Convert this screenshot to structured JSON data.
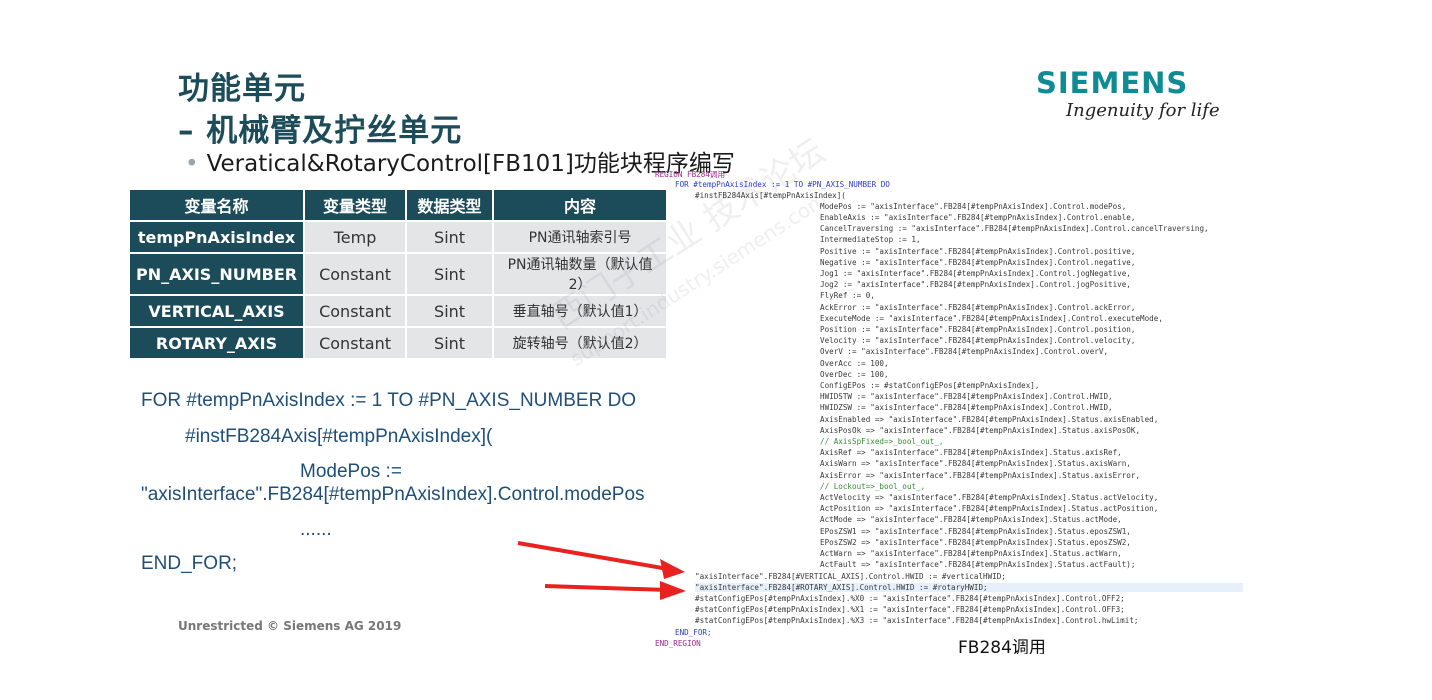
{
  "slide": {
    "title_line1": "功能单元",
    "title_line2": "– 机械臂及拧丝单元",
    "bullet_dot": "•",
    "bullet": "Veratical&RotaryControl[FB101]功能块程序编写",
    "logo": "SIEMENS",
    "tagline": "Ingenuity for life",
    "footer": "Unrestricted © Siemens AG 2019"
  },
  "table": {
    "headers": [
      "变量名称",
      "变量类型",
      "数据类型",
      "内容"
    ],
    "rows": [
      {
        "name": "tempPnAxisIndex",
        "vartype": "Temp",
        "datatype": "Sint",
        "content": "PN通讯轴索引号"
      },
      {
        "name": "PN_AXIS_NUMBER",
        "vartype": "Constant",
        "datatype": "Sint",
        "content": "PN通讯轴数量（默认值2）"
      },
      {
        "name": "VERTICAL_AXIS",
        "vartype": "Constant",
        "datatype": "Sint",
        "content": "垂直轴号（默认值1）"
      },
      {
        "name": "ROTARY_AXIS",
        "vartype": "Constant",
        "datatype": "Sint",
        "content": "旋转轴号（默认值2）"
      }
    ]
  },
  "code": {
    "line1": "FOR #tempPnAxisIndex := 1 TO #PN_AXIS_NUMBER DO",
    "line2": "#instFB284Axis[#tempPnAxisIndex](",
    "line3": "ModePos :=",
    "line4": "\"axisInterface\".FB284[#tempPnAxisIndex].Control.modePos",
    "line5": "......",
    "line6": "END_FOR;"
  },
  "scl": {
    "lines": [
      "REGION FB284调用",
      "FOR #tempPnAxisIndex := 1 TO #PN_AXIS_NUMBER DO",
      "#instFB284Axis[#tempPnAxisIndex](",
      "ModePos := \"axisInterface\".FB284[#tempPnAxisIndex].Control.modePos,",
      "EnableAxis := \"axisInterface\".FB284[#tempPnAxisIndex].Control.enable,",
      "CancelTraversing := \"axisInterface\".FB284[#tempPnAxisIndex].Control.cancelTraversing,",
      "IntermediateStop := 1,",
      "Positive := \"axisInterface\".FB284[#tempPnAxisIndex].Control.positive,",
      "Negative := \"axisInterface\".FB284[#tempPnAxisIndex].Control.negative,",
      "Jog1 := \"axisInterface\".FB284[#tempPnAxisIndex].Control.jogNegative,",
      "Jog2 := \"axisInterface\".FB284[#tempPnAxisIndex].Control.jogPositive,",
      "FlyRef := 0,",
      "AckError := \"axisInterface\".FB284[#tempPnAxisIndex].Control.ackError,",
      "ExecuteMode := \"axisInterface\".FB284[#tempPnAxisIndex].Control.executeMode,",
      "Position := \"axisInterface\".FB284[#tempPnAxisIndex].Control.position,",
      "Velocity := \"axisInterface\".FB284[#tempPnAxisIndex].Control.velocity,",
      "OverV := \"axisInterface\".FB284[#tempPnAxisIndex].Control.overV,",
      "OverAcc := 100,",
      "OverDec := 100,",
      "ConfigEPos := #statConfigEPos[#tempPnAxisIndex],",
      "HWIDSTW := \"axisInterface\".FB284[#tempPnAxisIndex].Control.HWID,",
      "HWIDZSW := \"axisInterface\".FB284[#tempPnAxisIndex].Control.HWID,",
      "AxisEnabled => \"axisInterface\".FB284[#tempPnAxisIndex].Status.axisEnabled,",
      "AxisPosOk => \"axisInterface\".FB284[#tempPnAxisIndex].Status.axisPosOK,",
      "// AxisSpFixed=>_bool_out_,",
      "AxisRef => \"axisInterface\".FB284[#tempPnAxisIndex].Status.axisRef,",
      "AxisWarn => \"axisInterface\".FB284[#tempPnAxisIndex].Status.axisWarn,",
      "AxisError => \"axisInterface\".FB284[#tempPnAxisIndex].Status.axisError,",
      "// Lockout=>_bool_out_,",
      "ActVelocity => \"axisInterface\".FB284[#tempPnAxisIndex].Status.actVelocity,",
      "ActPosition => \"axisInterface\".FB284[#tempPnAxisIndex].Status.actPosition,",
      "ActMode => \"axisInterface\".FB284[#tempPnAxisIndex].Status.actMode,",
      "EPosZSW1 => \"axisInterface\".FB284[#tempPnAxisIndex].Status.eposZSW1,",
      "EPosZSW2 => \"axisInterface\".FB284[#tempPnAxisIndex].Status.eposZSW2,",
      "ActWarn => \"axisInterface\".FB284[#tempPnAxisIndex].Status.actWarn,",
      "ActFault => \"axisInterface\".FB284[#tempPnAxisIndex].Status.actFault);",
      "\"axisInterface\".FB284[#VERTICAL_AXIS].Control.HWID := #verticalHWID;",
      "\"axisInterface\".FB284[#ROTARY_AXIS].Control.HWID := #rotaryHWID;",
      "#statConfigEPos[#tempPnAxisIndex].%X0 := \"axisInterface\".FB284[#tempPnAxisIndex].Control.OFF2;",
      "#statConfigEPos[#tempPnAxisIndex].%X1 := \"axisInterface\".FB284[#tempPnAxisIndex].Control.OFF3;",
      "#statConfigEPos[#tempPnAxisIndex].%X3 := \"axisInterface\".FB284[#tempPnAxisIndex].Control.hwLimit;",
      "END_FOR;",
      "END_REGION"
    ],
    "caption": "FB284调用"
  },
  "watermark": {
    "text1": "西门子工业 技术论坛",
    "text2": "support.industry.siemens.com"
  },
  "colors": {
    "title": "#1c4b5a",
    "table_header": "#1c4b5a",
    "table_cell": "#e3e5e7",
    "logo": "#0f8b96",
    "code": "#1f4e79",
    "arrow": "#e8231f"
  }
}
